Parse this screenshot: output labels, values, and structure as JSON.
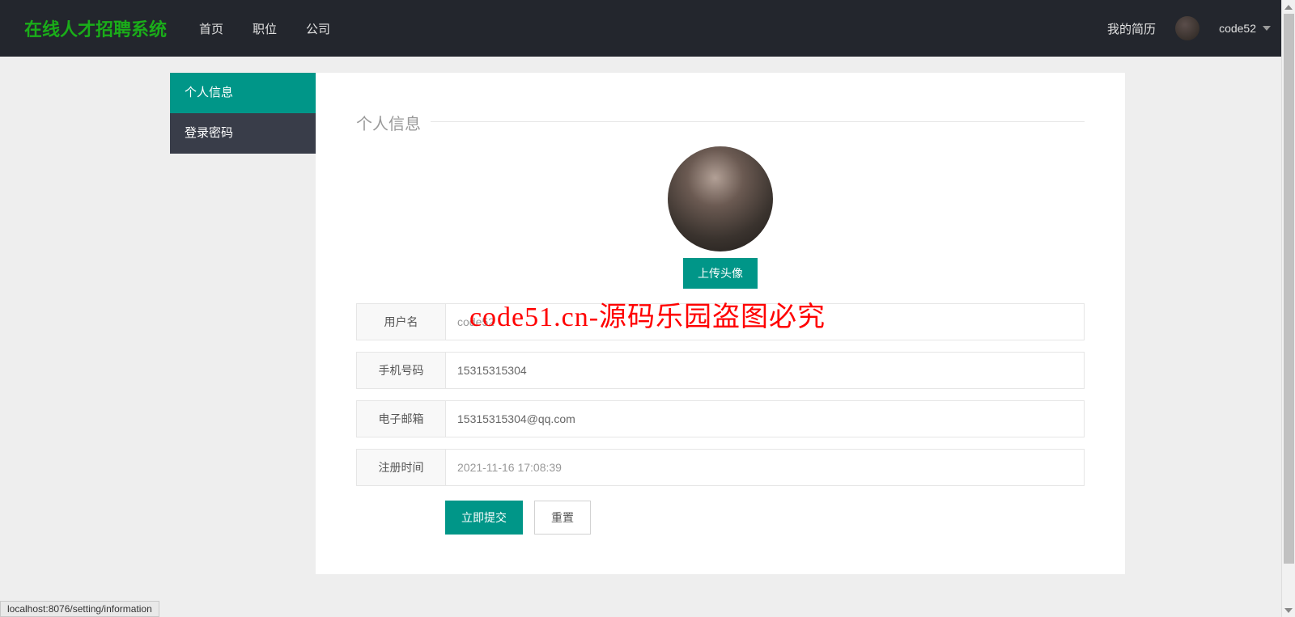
{
  "brand": "在线人才招聘系统",
  "nav": {
    "links": [
      "首页",
      "职位",
      "公司"
    ],
    "my_resume": "我的简历",
    "username": "code52"
  },
  "sidebar": {
    "items": [
      {
        "label": "个人信息",
        "active": true
      },
      {
        "label": "登录密码",
        "active": false
      }
    ]
  },
  "main": {
    "section_title": "个人信息",
    "upload_btn": "上传头像",
    "fields": {
      "username": {
        "label": "用户名",
        "value": "code52"
      },
      "phone": {
        "label": "手机号码",
        "value": "15315315304"
      },
      "email": {
        "label": "电子邮箱",
        "value": "15315315304@qq.com"
      },
      "regtime": {
        "label": "注册时间",
        "value": "2021-11-16 17:08:39"
      }
    },
    "submit": "立即提交",
    "reset": "重置"
  },
  "watermark": "code51.cn-源码乐园盗图必究",
  "status_url": "localhost:8076/setting/information"
}
